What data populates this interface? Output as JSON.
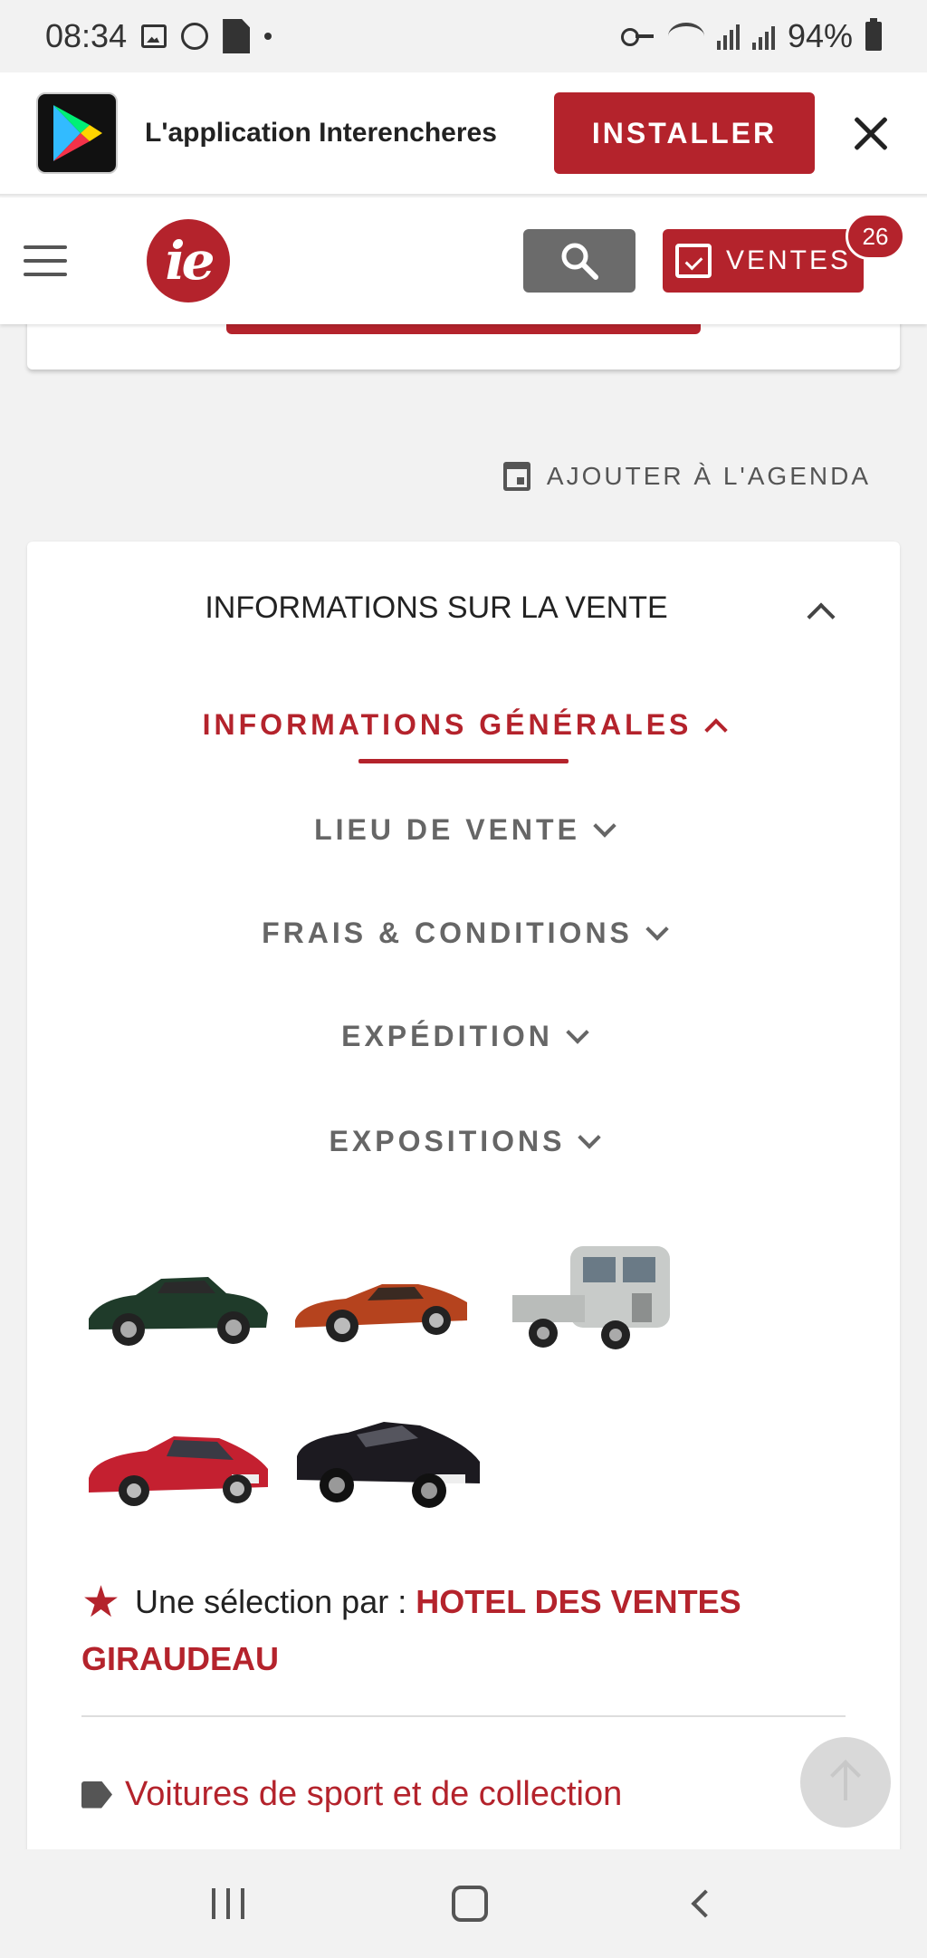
{
  "status_bar": {
    "time": "08:34",
    "battery": "94%"
  },
  "app_banner": {
    "title": "L'application Interencheres",
    "install_label": "INSTALLER",
    "icon": "google-play-icon"
  },
  "header": {
    "logo_text": "ie",
    "ventes_label": "VENTES",
    "ventes_badge": "26"
  },
  "agenda_label": "AJOUTER À L'AGENDA",
  "info_card": {
    "title": "INFORMATIONS SUR LA VENTE",
    "sections": [
      {
        "label": "INFORMATIONS GÉNÉRALES",
        "active": true
      },
      {
        "label": "LIEU DE VENTE",
        "active": false
      },
      {
        "label": "FRAIS & CONDITIONS",
        "active": false
      },
      {
        "label": "EXPÉDITION",
        "active": false
      },
      {
        "label": "EXPOSITIONS",
        "active": false
      }
    ],
    "selection_prefix": "Une sélection par :",
    "seller": "HOTEL DES VENTES GIRAUDEAU",
    "category": "Voitures de sport et de collection"
  },
  "colors": {
    "brand_red": "#b4232c",
    "search_grey": "#6b6b6b",
    "text_grey": "#666666"
  }
}
